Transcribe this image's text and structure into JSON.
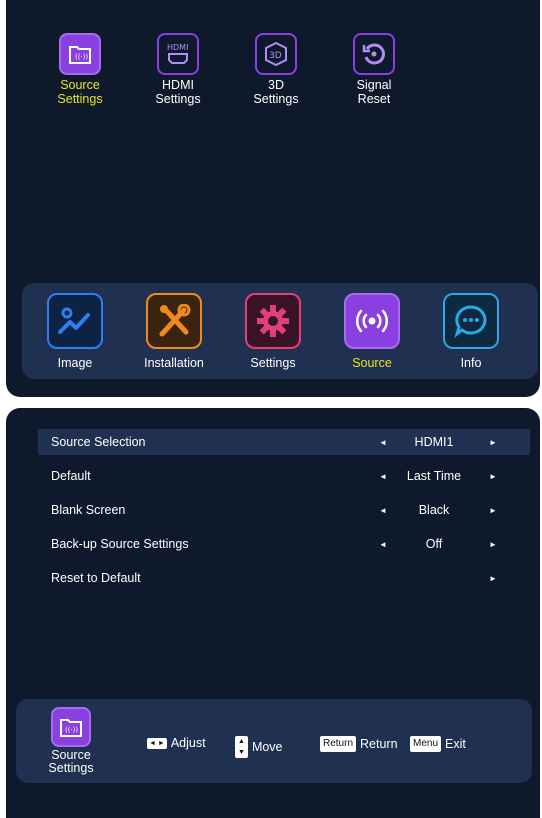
{
  "submenu": [
    {
      "label": "Source\nSettings",
      "icon": "folder-signal-icon",
      "active": true
    },
    {
      "label": "HDMI\nSettings",
      "icon": "hdmi-icon",
      "active": false
    },
    {
      "label": "3D\nSettings",
      "icon": "3d-icon",
      "active": false
    },
    {
      "label": "Signal\nReset",
      "icon": "signal-reset-icon",
      "active": false
    }
  ],
  "menubar": [
    {
      "label": "Image",
      "icon": "image-icon",
      "color": "#2f7ff0"
    },
    {
      "label": "Installation",
      "icon": "tools-icon",
      "color": "#f08a1c"
    },
    {
      "label": "Settings",
      "icon": "gear-icon",
      "color": "#e0407a"
    },
    {
      "label": "Source",
      "icon": "broadcast-icon",
      "color": "#8a3fe0",
      "active": true
    },
    {
      "label": "Info",
      "icon": "chat-icon",
      "color": "#2aa7e8"
    }
  ],
  "settings": [
    {
      "name": "Source Selection",
      "value": "HDMI1",
      "left": true,
      "right": true,
      "selected": true
    },
    {
      "name": "Default",
      "value": "Last Time",
      "left": true,
      "right": true
    },
    {
      "name": "Blank Screen",
      "value": "Black",
      "left": true,
      "right": true
    },
    {
      "name": "Back-up Source Settings",
      "value": "Off",
      "left": true,
      "right": true
    },
    {
      "name": "Reset to Default",
      "value": "",
      "left": false,
      "right": true
    }
  ],
  "footer": {
    "current": "Source\nSettings",
    "adjust_label": "Adjust",
    "move_label": "Move",
    "return_key": "Return",
    "return_label": "Return",
    "menu_key": "Menu",
    "exit_label": "Exit"
  },
  "colors": {
    "panel": "#0e1a2c",
    "bar": "#1f3050",
    "accent": "#8a3fe0",
    "active_text": "#e8e81a"
  }
}
